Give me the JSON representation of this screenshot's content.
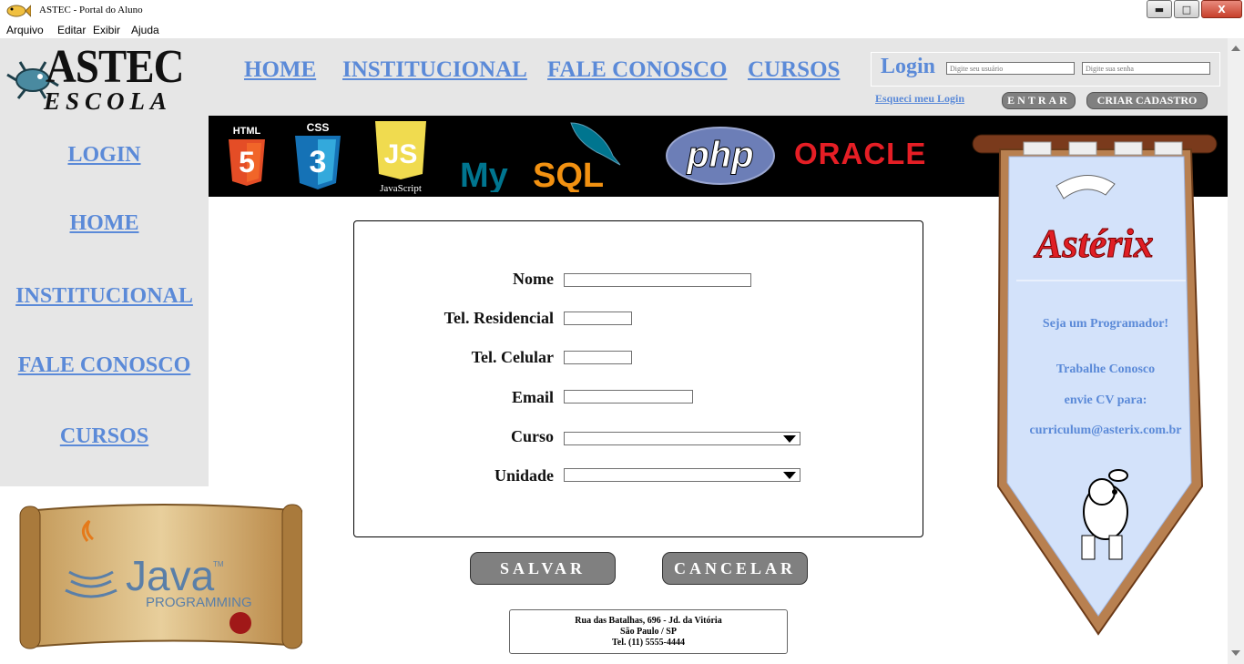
{
  "window": {
    "title": "ASTEC - Portal do Aluno",
    "minimize": "▬",
    "maximize": "□",
    "close": "X"
  },
  "menu": [
    "Arquivo",
    "Editar",
    "Exibir",
    "Ajuda"
  ],
  "logo": {
    "line1": "ASTEC",
    "line2": "ESCOLA"
  },
  "topnav": [
    "HOME",
    "INSTITUCIONAL",
    "FALE CONOSCO",
    "CURSOS"
  ],
  "login": {
    "label": "Login",
    "user_placeholder": "Digite seu usuário",
    "pass_placeholder": "Digite sua senha",
    "forgot": "Esqueci meu Login",
    "enter": "ENTRAR",
    "register": "CRIAR CADASTRO"
  },
  "sidebar": [
    "LOGIN",
    "HOME",
    "INSTITUCIONAL",
    "FALE CONOSCO",
    "CURSOS"
  ],
  "tech": {
    "html": "HTML",
    "html_num": "5",
    "css": "CSS",
    "css_num": "3",
    "js": "JS",
    "js_caption": "JavaScript",
    "mysql_a": "My",
    "mysql_b": "SQL",
    "php": "php",
    "oracle": "ORACLE"
  },
  "form": {
    "nome": "Nome",
    "tel_res": "Tel. Residencial",
    "tel_cel": "Tel. Celular",
    "email": "Email",
    "curso": "Curso",
    "unidade": "Unidade",
    "save": "SALVAR",
    "cancel": "CANCELAR"
  },
  "address": {
    "line1": "Rua das Batalhas, 696 - Jd. da Vitória",
    "line2": "São Paulo / SP",
    "line3": "Tel. (11) 5555-4444"
  },
  "java_ad": {
    "word": "Java",
    "tm": "TM",
    "sub": "PROGRAMMING"
  },
  "banner": {
    "brand": "Astérix",
    "line1": "Seja um Programador!",
    "line2": "Trabalhe Conosco",
    "line3": "envie CV para:",
    "line4": "curriculum@asterix.com.br"
  }
}
